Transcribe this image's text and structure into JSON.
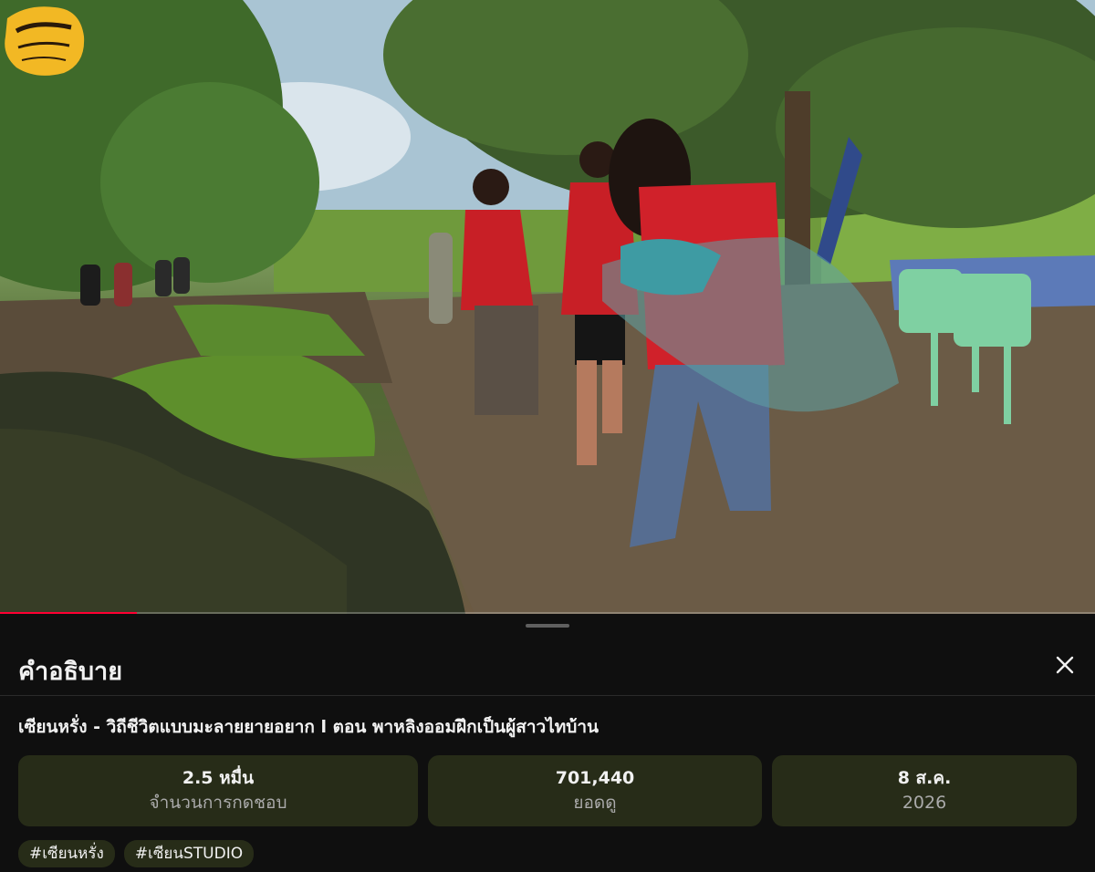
{
  "video": {
    "progress_fraction": 0.125,
    "logo_icon": "channel-logo-icon"
  },
  "description": {
    "heading": "คำอธิบาย",
    "close_icon": "close-icon",
    "video_title": "เซียนหรั่ง - วิถีชีวิตแบบมะลายยายอยาก l ตอน พาหลิงออมฝึกเป็นผู้สาวไทบ้าน",
    "stats": {
      "likes_value": "2.5 หมื่น",
      "likes_label": "จำนวนการกดชอบ",
      "views_value": "701,440",
      "views_label": "ยอดดู",
      "date_value": "8 ส.ค.",
      "date_label": "2026"
    },
    "hashtags": [
      "#เซียนหรั่ง",
      "#เซียนSTUDIO"
    ]
  },
  "colors": {
    "background": "#0f0f0f",
    "card": "#272c18",
    "progress": "#ff0033",
    "logo": "#f2b824"
  }
}
